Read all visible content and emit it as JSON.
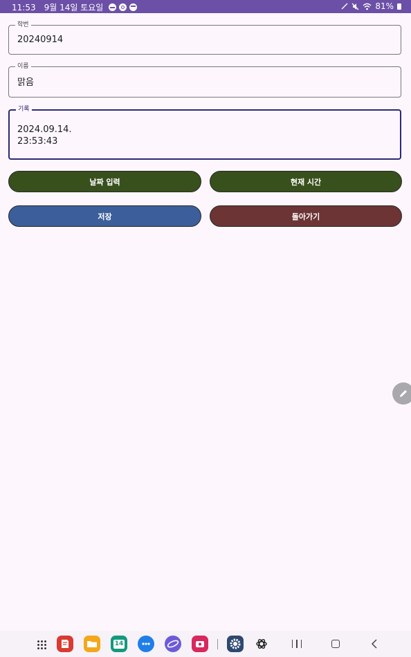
{
  "status_bar": {
    "time": "11:53",
    "date": "9월 14일 토요일",
    "battery": "81%"
  },
  "form": {
    "student_id": {
      "label": "학번",
      "value": "20240914"
    },
    "name": {
      "label": "이름",
      "value": "맑음"
    },
    "record": {
      "label": "기록",
      "value": "2024.09.14.\n23:53:43"
    }
  },
  "buttons": {
    "date_input": "날짜 입력",
    "current_time": "현재 시간",
    "save": "저장",
    "back": "돌아가기"
  },
  "colors": {
    "status_bar": "#6c4fa6",
    "green_button": "#38501c",
    "blue_button": "#3c5e9a",
    "red_button": "#6c3434",
    "focus_border": "#2c2877",
    "background": "#fdf7fd"
  },
  "taskbar": {
    "calendar_day": "14",
    "apps": [
      "apps-grid-icon",
      "notes-app-icon",
      "files-app-icon",
      "calendar-app-icon",
      "messages-app-icon",
      "internet-app-icon",
      "screen-recorder-app-icon",
      "settings-app-icon",
      "chatgpt-app-icon"
    ]
  }
}
